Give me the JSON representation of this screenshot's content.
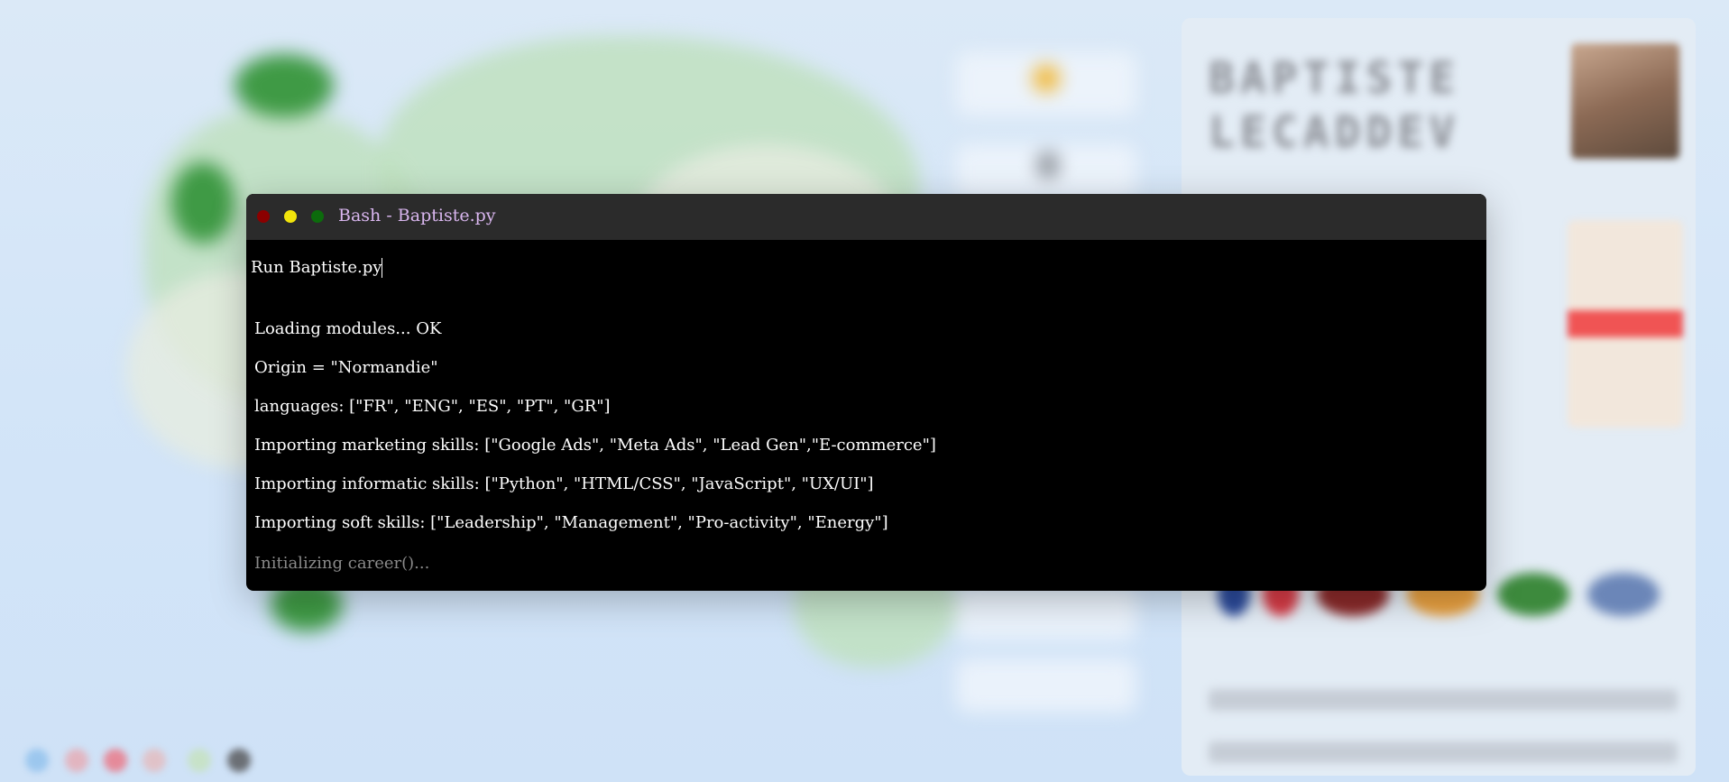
{
  "terminal": {
    "title": "Bash - Baptiste.py",
    "command": "Run Baptiste.py",
    "output": [
      "Loading modules... OK",
      "Origin = \"Normandie\"",
      "languages: [\"FR\", \"ENG\", \"ES\", \"PT\", \"GR\"]",
      "Importing marketing skills: [\"Google Ads\", \"Meta Ads\", \"Lead Gen\",\"E-commerce\"]",
      "Importing informatic skills: [\"Python\", \"HTML/CSS\", \"JavaScript\", \"UX/UI\"]",
      "Importing soft skills: [\"Leadership\", \"Management\", \"Pro-activity\", \"Energy\"]"
    ],
    "pending_line": "Initializing career()...",
    "colors": {
      "window_bg": "#000000",
      "titlebar_bg": "#2b2b2b",
      "title_text": "#d9b6ef",
      "close_light": "#8b0000",
      "minimize_light": "#f1e40b",
      "maximize_light": "#0c6b0c",
      "pending_text": "#8a8a8a"
    }
  },
  "background": {
    "profile_name_line1": "BAPTISTE",
    "profile_name_line2": "LECADDEV"
  }
}
